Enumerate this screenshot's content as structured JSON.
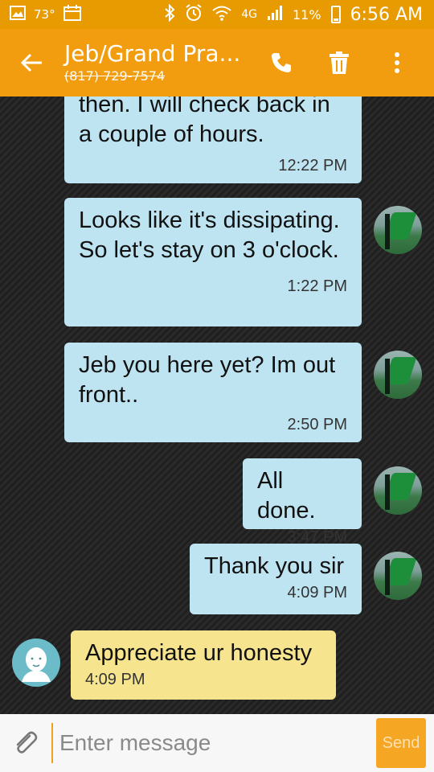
{
  "status_bar": {
    "temperature": "73°",
    "network": "4G",
    "battery_percent": "11%",
    "time": "6:56 AM",
    "icons": [
      "image-icon",
      "calendar-icon",
      "bluetooth-icon",
      "alarm-icon",
      "wifi-icon",
      "signal-icon",
      "battery-icon"
    ]
  },
  "app_bar": {
    "title": "Jeb/Grand Pra...",
    "subtitle": "(817) 729-7574",
    "actions": [
      "phone-icon",
      "trash-icon",
      "more-icon"
    ]
  },
  "messages": [
    {
      "direction": "outgoing",
      "text": "then. I will check back in a couple of hours.",
      "time": "12:22 PM"
    },
    {
      "direction": "outgoing",
      "text": "Looks like it's dissipating. So let's stay on 3 o'clock.",
      "time": "1:22 PM"
    },
    {
      "direction": "outgoing",
      "text": "Jeb you here yet? Im out front..",
      "time": "2:50 PM"
    },
    {
      "direction": "outgoing",
      "text": "All done.",
      "time": "3:47 PM"
    },
    {
      "direction": "outgoing",
      "text": "Thank you sir",
      "time": "4:09 PM"
    },
    {
      "direction": "incoming",
      "text": "Appreciate ur honesty",
      "time": "4:09 PM"
    }
  ],
  "composer": {
    "placeholder": "Enter message",
    "send_label": "Send"
  },
  "colors": {
    "status_bar": "#e89b00",
    "app_bar": "#f29d0f",
    "outgoing_bubble": "#bfe4f1",
    "incoming_bubble": "#f6e58e",
    "send_button": "#f5a623"
  }
}
